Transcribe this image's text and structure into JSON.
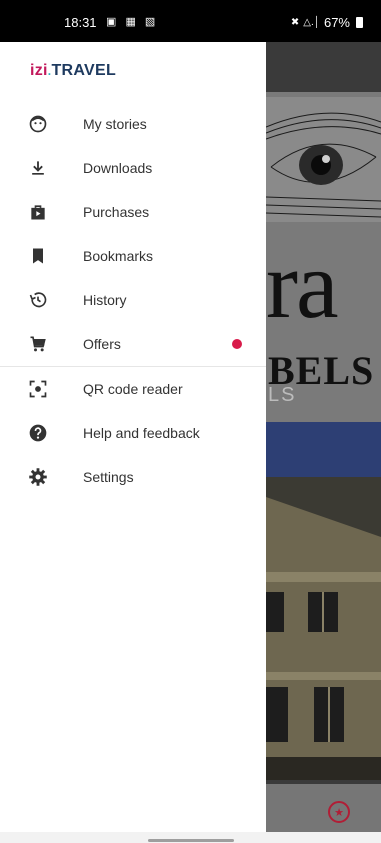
{
  "status_bar": {
    "time": "18:31",
    "notification_icons": "▣ ▦ ▧",
    "battery_percent": "67%",
    "mute_icon": "✖",
    "signal_icons": "△.│"
  },
  "logo": {
    "izi": "izi",
    "dot": ".",
    "travel": "TRAVEL"
  },
  "colors": {
    "logo_izi": "#c2185b",
    "logo_travel": "#1e3a5f",
    "badge": "#d81b4a"
  },
  "menu": {
    "items": [
      {
        "label": "My stories",
        "icon": "face-icon"
      },
      {
        "label": "Downloads",
        "icon": "download-icon"
      },
      {
        "label": "Purchases",
        "icon": "shopping-bag-icon"
      },
      {
        "label": "Bookmarks",
        "icon": "bookmark-icon"
      },
      {
        "label": "History",
        "icon": "history-icon"
      },
      {
        "label": "Offers",
        "icon": "cart-icon"
      },
      {
        "label": "QR code reader",
        "icon": "qr-scan-icon"
      },
      {
        "label": "Help and feedback",
        "icon": "help-icon"
      },
      {
        "label": "Settings",
        "icon": "gear-icon"
      }
    ]
  },
  "background": {
    "big_text": "ra",
    "sub_text": "BELS",
    "small_text": "LS"
  }
}
